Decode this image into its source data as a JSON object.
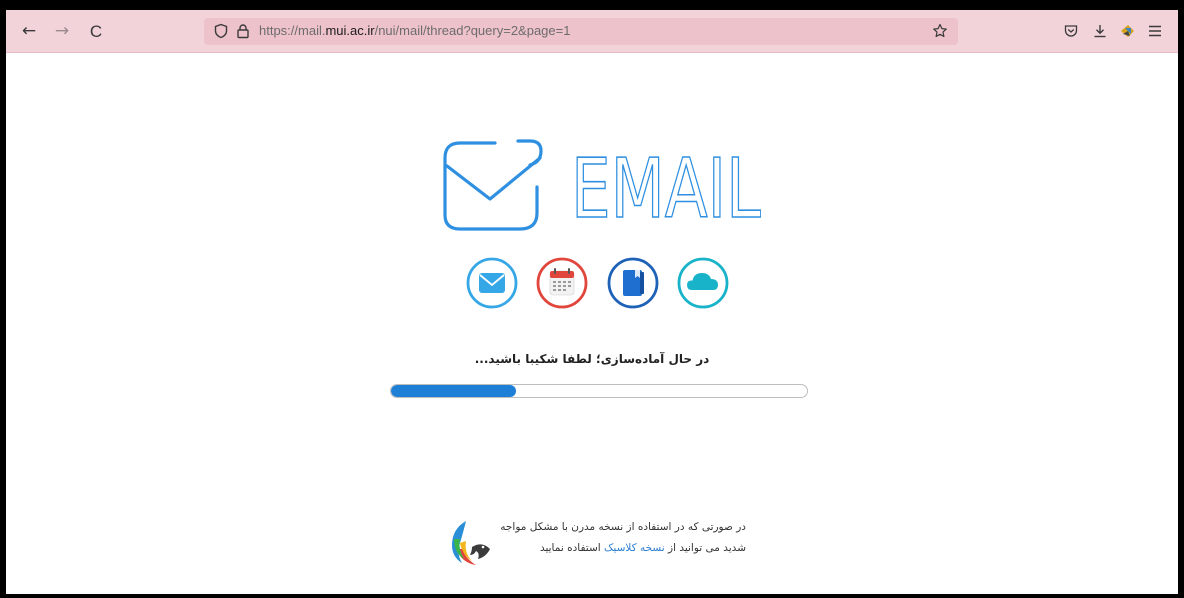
{
  "browser": {
    "url_prefix": "https://mail.",
    "url_domain": "mui.ac.ir",
    "url_path": "/nui/mail/thread?query=2&page=1",
    "nav": {
      "back": "←",
      "forward": "→",
      "reload": "C"
    },
    "icons": {
      "shield": "shield-icon",
      "lock": "lock-icon",
      "bookmark": "star-icon",
      "pocket": "pocket-icon",
      "downloads": "download-icon",
      "extension": "extension-icon",
      "menu": "hamburger-menu-icon"
    }
  },
  "brand": {
    "wordmark": "EMAIL",
    "color": "#2f8fe0"
  },
  "apps": [
    {
      "name": "mail",
      "icon": "envelope-icon",
      "color": "#36a7e6"
    },
    {
      "name": "calendar",
      "icon": "calendar-icon",
      "color": "#e0463c"
    },
    {
      "name": "contacts",
      "icon": "book-icon",
      "color": "#1e62b8"
    },
    {
      "name": "cloud",
      "icon": "cloud-icon",
      "color": "#19b3c9"
    }
  ],
  "loading": {
    "message": "در حال آماده‌سازی؛ لطفا شکیبا باشید...",
    "progress_fraction": 0.3,
    "progress_color": "#1e7fd6"
  },
  "footer": {
    "line1": "در صورتی که در استفاده از نسخه مدرن با مشکل مواجه",
    "line2_prefix": "شدید می توانید از ",
    "link_text": "نسخه کلاسیک",
    "line2_suffix": " استفاده نمایید"
  }
}
